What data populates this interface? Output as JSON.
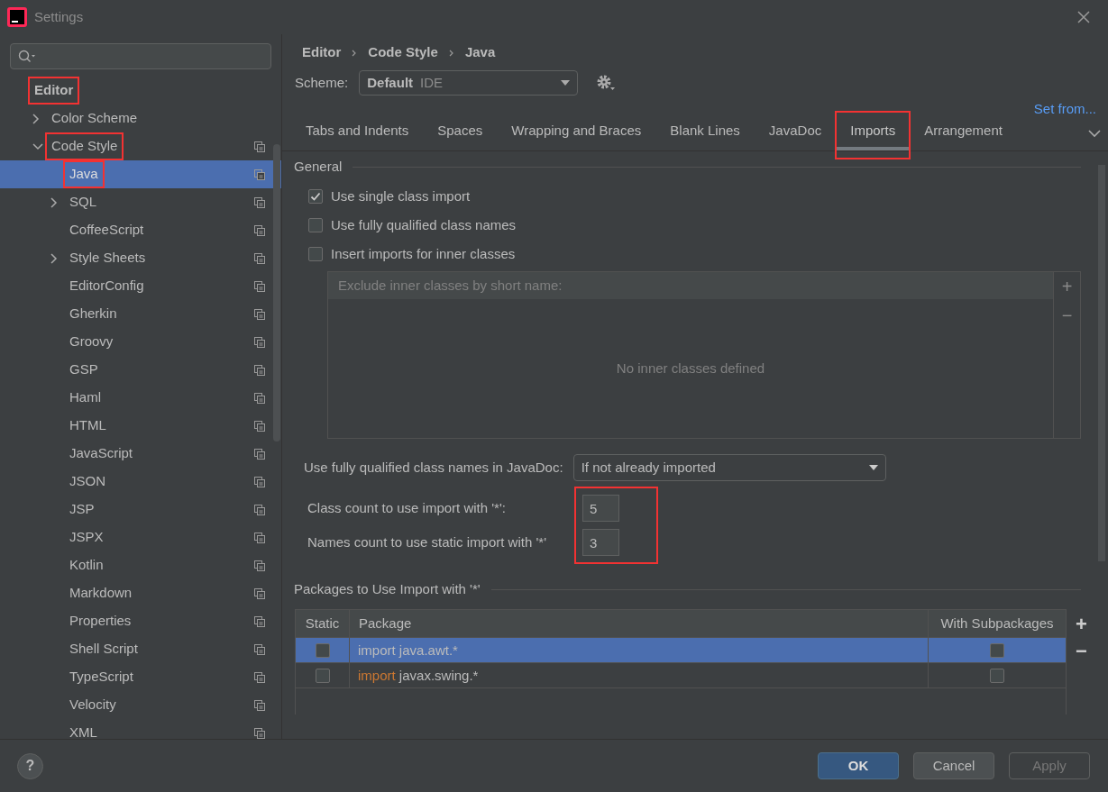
{
  "window": {
    "title": "Settings"
  },
  "sidebar": {
    "tree": [
      {
        "label": "Editor",
        "kind": "header",
        "selected": false,
        "annotated": true,
        "copy_icon": false,
        "children": [
          {
            "label": "Color Scheme",
            "kind": "item",
            "expanded": false,
            "selected": false,
            "annotated": false,
            "copy_icon": false
          },
          {
            "label": "Code Style",
            "kind": "item",
            "expanded": true,
            "selected": false,
            "annotated": true,
            "copy_icon": true,
            "children": [
              {
                "label": "Java",
                "kind": "item",
                "selected": true,
                "annotated": true,
                "copy_icon": true
              },
              {
                "label": "SQL",
                "kind": "item",
                "expanded": false,
                "selected": false,
                "annotated": false,
                "copy_icon": true
              },
              {
                "label": "CoffeeScript",
                "kind": "item",
                "selected": false,
                "annotated": false,
                "copy_icon": true
              },
              {
                "label": "Style Sheets",
                "kind": "item",
                "expanded": false,
                "selected": false,
                "annotated": false,
                "copy_icon": true
              },
              {
                "label": "EditorConfig",
                "kind": "item",
                "selected": false,
                "annotated": false,
                "copy_icon": true
              },
              {
                "label": "Gherkin",
                "kind": "item",
                "selected": false,
                "annotated": false,
                "copy_icon": true
              },
              {
                "label": "Groovy",
                "kind": "item",
                "selected": false,
                "annotated": false,
                "copy_icon": true
              },
              {
                "label": "GSP",
                "kind": "item",
                "selected": false,
                "annotated": false,
                "copy_icon": true
              },
              {
                "label": "Haml",
                "kind": "item",
                "selected": false,
                "annotated": false,
                "copy_icon": true
              },
              {
                "label": "HTML",
                "kind": "item",
                "selected": false,
                "annotated": false,
                "copy_icon": true
              },
              {
                "label": "JavaScript",
                "kind": "item",
                "selected": false,
                "annotated": false,
                "copy_icon": true
              },
              {
                "label": "JSON",
                "kind": "item",
                "selected": false,
                "annotated": false,
                "copy_icon": true
              },
              {
                "label": "JSP",
                "kind": "item",
                "selected": false,
                "annotated": false,
                "copy_icon": true
              },
              {
                "label": "JSPX",
                "kind": "item",
                "selected": false,
                "annotated": false,
                "copy_icon": true
              },
              {
                "label": "Kotlin",
                "kind": "item",
                "selected": false,
                "annotated": false,
                "copy_icon": true
              },
              {
                "label": "Markdown",
                "kind": "item",
                "selected": false,
                "annotated": false,
                "copy_icon": true
              },
              {
                "label": "Properties",
                "kind": "item",
                "selected": false,
                "annotated": false,
                "copy_icon": true
              },
              {
                "label": "Shell Script",
                "kind": "item",
                "selected": false,
                "annotated": false,
                "copy_icon": true
              },
              {
                "label": "TypeScript",
                "kind": "item",
                "selected": false,
                "annotated": false,
                "copy_icon": true
              },
              {
                "label": "Velocity",
                "kind": "item",
                "selected": false,
                "annotated": false,
                "copy_icon": true
              },
              {
                "label": "XML",
                "kind": "item",
                "selected": false,
                "annotated": false,
                "copy_icon": true
              }
            ]
          }
        ]
      }
    ]
  },
  "breadcrumb": [
    "Editor",
    "Code Style",
    "Java"
  ],
  "scheme": {
    "label": "Scheme:",
    "value": "Default",
    "qualifier": "IDE"
  },
  "set_from": "Set from...",
  "tabs": [
    {
      "label": "Tabs and Indents",
      "selected": false,
      "annotated": false
    },
    {
      "label": "Spaces",
      "selected": false,
      "annotated": false
    },
    {
      "label": "Wrapping and Braces",
      "selected": false,
      "annotated": false
    },
    {
      "label": "Blank Lines",
      "selected": false,
      "annotated": false
    },
    {
      "label": "JavaDoc",
      "selected": false,
      "annotated": false
    },
    {
      "label": "Imports",
      "selected": true,
      "annotated": true
    },
    {
      "label": "Arrangement",
      "selected": false,
      "annotated": false
    }
  ],
  "general": {
    "title": "General",
    "options": [
      {
        "label": "Use single class import",
        "checked": true
      },
      {
        "label": "Use fully qualified class names",
        "checked": false
      },
      {
        "label": "Insert imports for inner classes",
        "checked": false
      }
    ],
    "exclude_list": {
      "header": "Exclude inner classes by short name:",
      "empty_text": "No inner classes defined",
      "add": "+",
      "remove": "−"
    },
    "javadoc": {
      "label": "Use fully qualified class names in JavaDoc:",
      "value": "If not already imported"
    },
    "counts": {
      "annotated": true,
      "items": [
        {
          "label": "Class count to use import with '*':",
          "value": "5"
        },
        {
          "label": "Names count to use static import with '*'",
          "value": "3"
        }
      ]
    }
  },
  "packages": {
    "title": "Packages to Use Import with '*'",
    "columns": [
      "Static",
      "Package",
      "With Subpackages"
    ],
    "rows": [
      {
        "static": false,
        "keyword": "import",
        "package": "java.awt.*",
        "with_subpackages": false,
        "selected": true
      },
      {
        "static": false,
        "keyword": "import",
        "package": "javax.swing.*",
        "with_subpackages": false,
        "selected": false
      }
    ],
    "add": "+",
    "remove": "−"
  },
  "buttons": [
    {
      "label": "OK",
      "kind": "default",
      "disabled": false
    },
    {
      "label": "Cancel",
      "kind": "normal",
      "disabled": false
    },
    {
      "label": "Apply",
      "kind": "normal",
      "disabled": true
    }
  ],
  "help": "?"
}
